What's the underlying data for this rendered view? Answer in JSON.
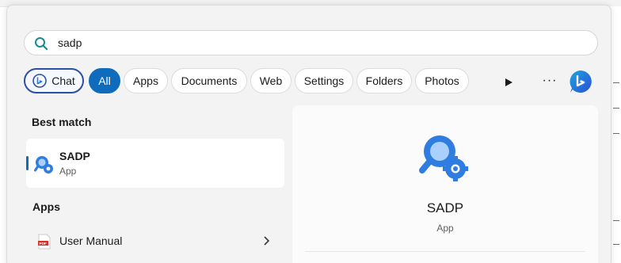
{
  "search": {
    "query": "sadp"
  },
  "filters": {
    "chat": "Chat",
    "all": "All",
    "apps": "Apps",
    "documents": "Documents",
    "web": "Web",
    "settings": "Settings",
    "folders": "Folders",
    "photos": "Photos",
    "more": "···"
  },
  "left": {
    "best_match_title": "Best match",
    "best_match": {
      "name": "SADP",
      "type": "App"
    },
    "apps_title": "Apps",
    "apps": [
      {
        "name": "User Manual",
        "icon": "pdf-icon"
      }
    ]
  },
  "preview": {
    "name": "SADP",
    "type": "App"
  },
  "colors": {
    "accent": "#0f6cbd",
    "sadp_blue": "#2f7de1",
    "pdf_red": "#d93025"
  }
}
